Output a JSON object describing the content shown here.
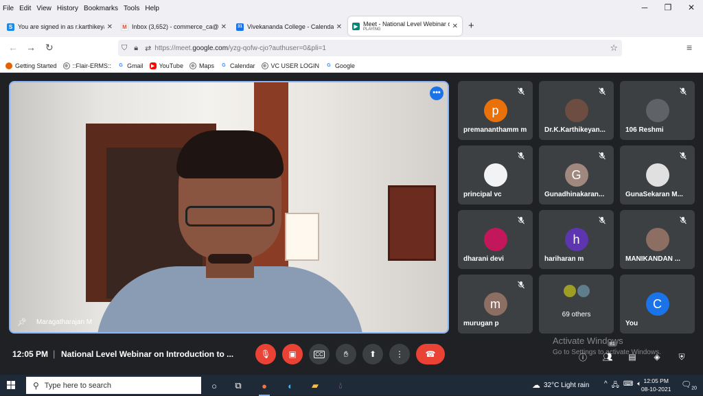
{
  "browser": {
    "menu": [
      "File",
      "Edit",
      "View",
      "History",
      "Bookmarks",
      "Tools",
      "Help"
    ],
    "tabs": [
      {
        "label": "You are signed in as r.karthikeya",
        "icon": "S"
      },
      {
        "label": "Inbox (3,652) - commerce_ca@",
        "icon": "M"
      },
      {
        "label": "Vivekananda College - Calendar",
        "icon": "31"
      },
      {
        "label": "Meet - National Level Webinar o",
        "sub": "PLAYING",
        "icon": "meet"
      }
    ],
    "new_tab": "+",
    "url_prefix": "https://meet.",
    "url_domain": "google.com",
    "url_path": "/yzg-qofw-cjo?authuser=0&pli=1",
    "bookmarks": [
      "Getting Started",
      "::Flair-ERMS::",
      "Gmail",
      "YouTube",
      "Maps",
      "Calendar",
      "VC USER LOGIN",
      "Google"
    ]
  },
  "meet": {
    "main_speaker": "Maragatharajan M",
    "tiles": [
      {
        "name": "premananthammm",
        "display": "premananthamm m",
        "initial": "p",
        "color": "#e8710a"
      },
      {
        "name": "Dr.K.Karthikeyan",
        "display": "Dr.K.Karthikeyan...",
        "initial": "",
        "color": "#6d4c41"
      },
      {
        "name": "106 Reshmi",
        "display": "106 Reshmi",
        "initial": "",
        "color": "#5f6368"
      },
      {
        "name": "principal vc",
        "display": "principal vc",
        "initial": "",
        "color": "#f1f3f4"
      },
      {
        "name": "Gunadhinakaran",
        "display": "Gunadhinakaran...",
        "initial": "G",
        "color": "#a1887f"
      },
      {
        "name": "GunaSekaran M",
        "display": "GunaSekaran M...",
        "initial": "",
        "color": "#e0e0e0"
      },
      {
        "name": "dharani devi",
        "display": "dharani devi",
        "initial": "",
        "color": "#c2185b"
      },
      {
        "name": "hariharan m",
        "display": "hariharan m",
        "initial": "h",
        "color": "#5e35b1"
      },
      {
        "name": "MANIKANDAN",
        "display": "MANIKANDAN ...",
        "initial": "",
        "color": "#8d6e63"
      },
      {
        "name": "murugan p",
        "display": "murugan p",
        "initial": "m",
        "color": "#8d6e63"
      },
      {
        "name": "others",
        "display": "69 others",
        "initial": "",
        "color": "#3c4043"
      },
      {
        "name": "You",
        "display": "You",
        "initial": "C",
        "color": "#1a73e8"
      }
    ],
    "time": "12:05 PM",
    "separator": "|",
    "meeting_title": "National Level Webinar on Introduction to ...",
    "participant_count": "81",
    "watermark_title": "Activate Windows",
    "watermark_sub": "Go to Settings to activate Windows."
  },
  "taskbar": {
    "search_placeholder": "Type here to search",
    "weather": "32°C  Light rain",
    "time": "12:05 PM",
    "date": "08-10-2021",
    "notif_count": "20"
  }
}
